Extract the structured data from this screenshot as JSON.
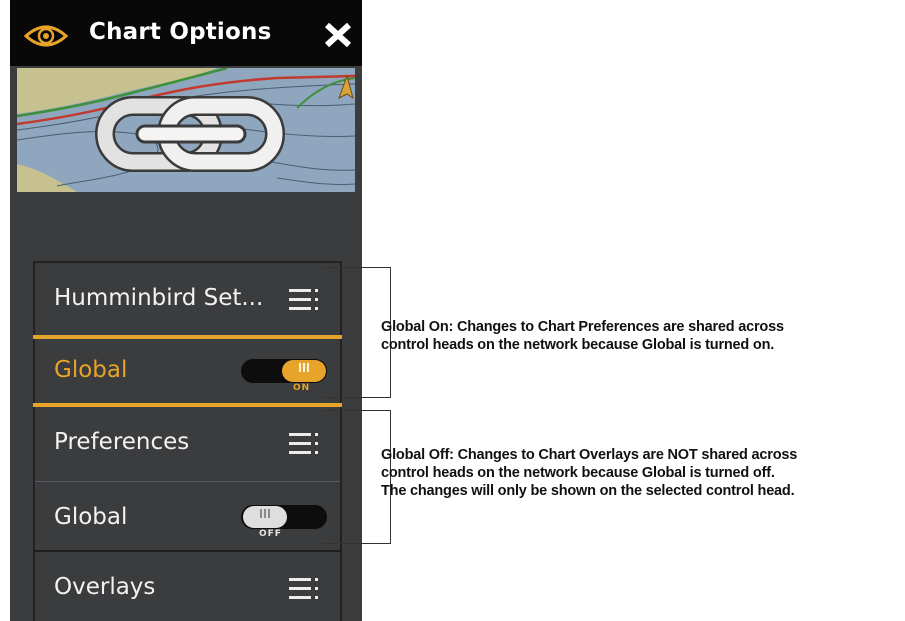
{
  "header": {
    "title": "Chart Options",
    "eye_icon": "eye-icon",
    "close_icon": "close-icon"
  },
  "chart_graphic": {
    "icon": "chain-link-icon",
    "accent_colors": {
      "land": "#c6c18f",
      "water": "#8fa6bf",
      "contour_red": "#c23a2e",
      "contour_green": "#3f8f3b"
    }
  },
  "menu": {
    "humminbird": {
      "label": "Humminbird Set..."
    },
    "global_on": {
      "label": "Global",
      "toggle_state": "ON",
      "enabled": true
    },
    "preferences": {
      "label": "Preferences"
    },
    "global_off": {
      "label": "Global",
      "toggle_state": "OFF",
      "enabled": false
    },
    "overlays": {
      "label": "Overlays"
    }
  },
  "callouts": {
    "global_on": {
      "heading": "Global On:",
      "line1": "Changes to Chart Preferences are shared across",
      "line2": "control heads on the network because Global is turned on."
    },
    "global_off": {
      "heading": "Global Off:",
      "line1": "Changes to Chart Overlays are NOT shared across",
      "line2": "control heads on the network because Global is turned off.",
      "line3": "The changes will only be shown on the selected control head."
    }
  },
  "colors": {
    "accent": "#e8a42a",
    "panel_bg": "#3b3c3e",
    "header_bg": "#080808",
    "text_light": "#f2f2f2"
  }
}
